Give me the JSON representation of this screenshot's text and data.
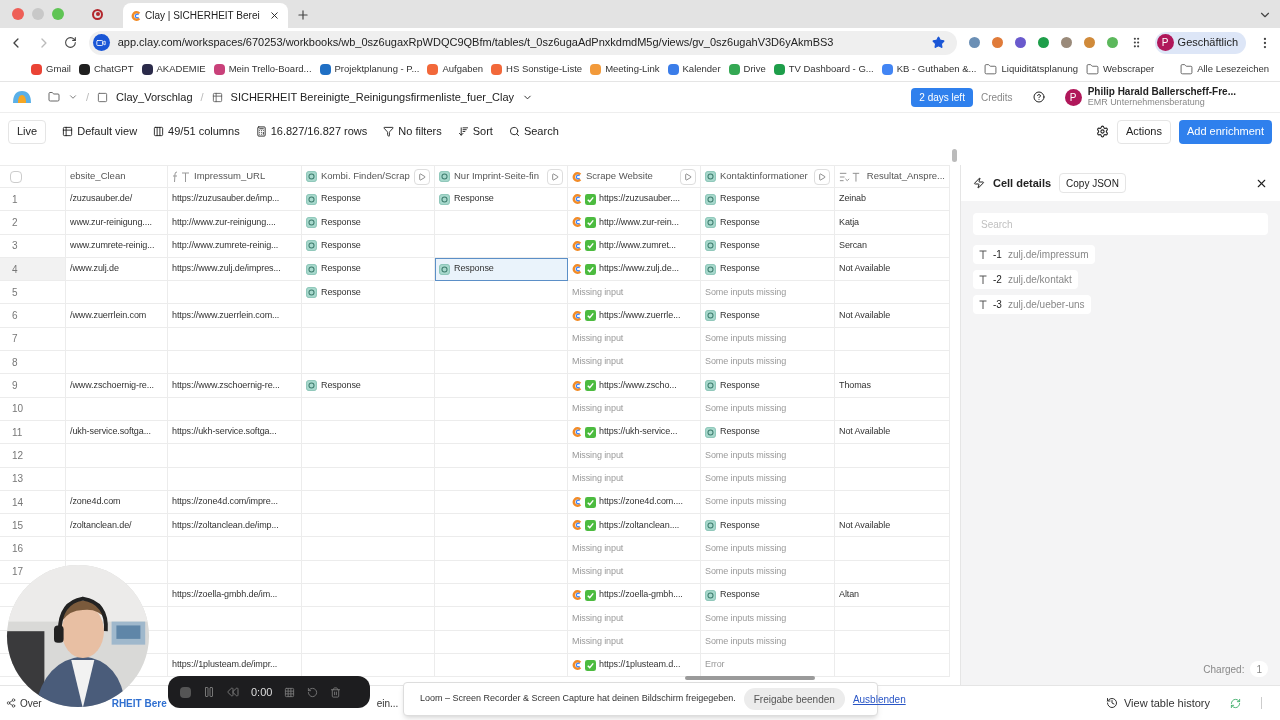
{
  "browser": {
    "tab_title": "Clay | SICHERHEIT Berei",
    "url": "app.clay.com/workspaces/670253/workbooks/wb_0sz6ugaxRpWDQC9QBfm/tables/t_0sz6ugaAdPnxkdmdM5g/views/gv_0sz6ugahV3D6yAkmBS3",
    "profile": "Geschäftlich",
    "profile_initial": "P",
    "bookmarks": [
      {
        "label": "Gmail",
        "kind": "site",
        "color": "#ea4335"
      },
      {
        "label": "ChatGPT",
        "kind": "site",
        "color": "#1f1f1f"
      },
      {
        "label": "AKADEMIE",
        "kind": "site",
        "color": "#2b2b4a"
      },
      {
        "label": "Mein Trello-Board...",
        "kind": "site",
        "color": "#c9417a"
      },
      {
        "label": "Projektplanung - P...",
        "kind": "site",
        "color": "#1f6fc4"
      },
      {
        "label": "Aufgaben",
        "kind": "site",
        "color": "#f2683a"
      },
      {
        "label": "HS Sonstige-Liste",
        "kind": "site",
        "color": "#f2683a"
      },
      {
        "label": "Meeting-Link",
        "kind": "site",
        "color": "#f29a3a"
      },
      {
        "label": "Kalender",
        "kind": "site",
        "color": "#3b7de9"
      },
      {
        "label": "Drive",
        "kind": "site",
        "color": "#34a853"
      },
      {
        "label": "TV Dashboard - G...",
        "kind": "site",
        "color": "#1e9e4a"
      },
      {
        "label": "KB - Guthaben &...",
        "kind": "site",
        "color": "#4285f4"
      },
      {
        "label": "Liquiditätsplanung",
        "kind": "folder"
      },
      {
        "label": "Webscraper",
        "kind": "folder"
      },
      {
        "label": "Alle Lesezeichen",
        "kind": "folder"
      }
    ]
  },
  "app_header": {
    "separator": "/",
    "breadcrumbs": [
      "Clay_Vorschlag",
      "SICHERHEIT Bereinigte_Reinigungsfirmenliste_fuer_Clay"
    ],
    "trial": "2 days left",
    "credits": "Credits",
    "user": {
      "initial": "P",
      "name": "Philip Harald Ballerscheff-Fre...",
      "org": "EMR Unternehmensberatung"
    }
  },
  "toolbar": {
    "mode": "Live",
    "view": "Default view",
    "columns": "49/51 columns",
    "rows": "16.827/16.827 rows",
    "filters": "No filters",
    "sort": "Sort",
    "search": "Search",
    "actions": "Actions",
    "add": "Add enrichment"
  },
  "table": {
    "select_all": {
      "checked": false
    },
    "columns": [
      {
        "label": "ebsite_Clean",
        "kind": "plain",
        "run": false
      },
      {
        "label": "Impressum_URL",
        "kind": "formula",
        "run": false
      },
      {
        "label": "Kombi. Finden/Scrap",
        "kind": "ai",
        "run": true
      },
      {
        "label": "Nur Imprint-Seite-fin",
        "kind": "ai",
        "run": true
      },
      {
        "label": "Scrape Website",
        "kind": "scrape",
        "run": true
      },
      {
        "label": "Kontaktinformationer",
        "kind": "ai",
        "run": true
      },
      {
        "label": "Resultat_Anspre...",
        "kind": "list",
        "run": false
      }
    ],
    "rows": [
      {
        "number": "1",
        "cells": [
          {
            "kind": "text",
            "text": "/zuzusauber.de/",
            "selected": false
          },
          {
            "kind": "text",
            "text": "https://zuzusauber.de/imp...",
            "selected": false
          },
          {
            "kind": "response",
            "text": "Response",
            "selected": false
          },
          {
            "kind": "response",
            "text": "Response",
            "selected": false
          },
          {
            "kind": "scrape",
            "text": "https://zuzusauber....",
            "selected": false
          },
          {
            "kind": "response",
            "text": "Response",
            "selected": false
          },
          {
            "kind": "text",
            "text": "Zeinab",
            "selected": false
          }
        ]
      },
      {
        "number": "2",
        "cells": [
          {
            "kind": "text",
            "text": "www.zur-reinigung....",
            "selected": false
          },
          {
            "kind": "text",
            "text": "http://www.zur-reinigung....",
            "selected": false
          },
          {
            "kind": "response",
            "text": "Response",
            "selected": false
          },
          {
            "kind": "empty",
            "selected": false
          },
          {
            "kind": "scrape",
            "text": "http://www.zur-rein...",
            "selected": false
          },
          {
            "kind": "response",
            "text": "Response",
            "selected": false
          },
          {
            "kind": "text",
            "text": "Katja",
            "selected": false
          }
        ]
      },
      {
        "number": "3",
        "cells": [
          {
            "kind": "text",
            "text": "www.zumrete-reinig...",
            "selected": false
          },
          {
            "kind": "text",
            "text": "http://www.zumrete-reinig...",
            "selected": false
          },
          {
            "kind": "response",
            "text": "Response",
            "selected": false
          },
          {
            "kind": "empty",
            "selected": false
          },
          {
            "kind": "scrape",
            "text": "http://www.zumret...",
            "selected": false
          },
          {
            "kind": "response",
            "text": "Response",
            "selected": false
          },
          {
            "kind": "text",
            "text": "Sercan",
            "selected": false
          }
        ]
      },
      {
        "number": "4",
        "cells": [
          {
            "kind": "text",
            "text": "/www.zulj.de",
            "selected": false
          },
          {
            "kind": "text",
            "text": "https://www.zulj.de/impres...",
            "selected": false
          },
          {
            "kind": "response",
            "text": "Response",
            "selected": false
          },
          {
            "kind": "response",
            "text": "Response",
            "selected": true
          },
          {
            "kind": "scrape",
            "text": "https://www.zulj.de...",
            "selected": false
          },
          {
            "kind": "response",
            "text": "Response",
            "selected": false
          },
          {
            "kind": "text",
            "text": "Not Available",
            "selected": false
          }
        ]
      },
      {
        "number": "5",
        "cells": [
          {
            "kind": "empty",
            "selected": false
          },
          {
            "kind": "empty",
            "selected": false
          },
          {
            "kind": "response",
            "text": "Response",
            "selected": false
          },
          {
            "kind": "empty",
            "selected": false
          },
          {
            "kind": "muted",
            "text": "Missing input",
            "selected": false
          },
          {
            "kind": "muted",
            "text": "Some inputs missing",
            "selected": false
          },
          {
            "kind": "empty",
            "selected": false
          }
        ]
      },
      {
        "number": "6",
        "cells": [
          {
            "kind": "text",
            "text": "/www.zuerrlein.com",
            "selected": false
          },
          {
            "kind": "text",
            "text": "https://www.zuerrlein.com...",
            "selected": false
          },
          {
            "kind": "empty",
            "selected": false
          },
          {
            "kind": "empty",
            "selected": false
          },
          {
            "kind": "scrape",
            "text": "https://www.zuerrle...",
            "selected": false
          },
          {
            "kind": "response",
            "text": "Response",
            "selected": false
          },
          {
            "kind": "text",
            "text": "Not Available",
            "selected": false
          }
        ]
      },
      {
        "number": "7",
        "cells": [
          {
            "kind": "empty",
            "selected": false
          },
          {
            "kind": "empty",
            "selected": false
          },
          {
            "kind": "empty",
            "selected": false
          },
          {
            "kind": "empty",
            "selected": false
          },
          {
            "kind": "muted",
            "text": "Missing input",
            "selected": false
          },
          {
            "kind": "muted",
            "text": "Some inputs missing",
            "selected": false
          },
          {
            "kind": "empty",
            "selected": false
          }
        ]
      },
      {
        "number": "8",
        "cells": [
          {
            "kind": "empty",
            "selected": false
          },
          {
            "kind": "empty",
            "selected": false
          },
          {
            "kind": "empty",
            "selected": false
          },
          {
            "kind": "empty",
            "selected": false
          },
          {
            "kind": "muted",
            "text": "Missing input",
            "selected": false
          },
          {
            "kind": "muted",
            "text": "Some inputs missing",
            "selected": false
          },
          {
            "kind": "empty",
            "selected": false
          }
        ]
      },
      {
        "number": "9",
        "cells": [
          {
            "kind": "text",
            "text": "/www.zschoernig-re...",
            "selected": false
          },
          {
            "kind": "text",
            "text": "https://www.zschoernig-re...",
            "selected": false
          },
          {
            "kind": "response",
            "text": "Response",
            "selected": false
          },
          {
            "kind": "empty",
            "selected": false
          },
          {
            "kind": "scrape",
            "text": "https://www.zscho...",
            "selected": false
          },
          {
            "kind": "response",
            "text": "Response",
            "selected": false
          },
          {
            "kind": "text",
            "text": "Thomas",
            "selected": false
          }
        ]
      },
      {
        "number": "10",
        "cells": [
          {
            "kind": "empty",
            "selected": false
          },
          {
            "kind": "empty",
            "selected": false
          },
          {
            "kind": "empty",
            "selected": false
          },
          {
            "kind": "empty",
            "selected": false
          },
          {
            "kind": "muted",
            "text": "Missing input",
            "selected": false
          },
          {
            "kind": "muted",
            "text": "Some inputs missing",
            "selected": false
          },
          {
            "kind": "empty",
            "selected": false
          }
        ]
      },
      {
        "number": "11",
        "cells": [
          {
            "kind": "text",
            "text": "/ukh-service.softga...",
            "selected": false
          },
          {
            "kind": "text",
            "text": "https://ukh-service.softga...",
            "selected": false
          },
          {
            "kind": "empty",
            "selected": false
          },
          {
            "kind": "empty",
            "selected": false
          },
          {
            "kind": "scrape",
            "text": "https://ukh-service...",
            "selected": false
          },
          {
            "kind": "response",
            "text": "Response",
            "selected": false
          },
          {
            "kind": "text",
            "text": "Not Available",
            "selected": false
          }
        ]
      },
      {
        "number": "12",
        "cells": [
          {
            "kind": "empty",
            "selected": false
          },
          {
            "kind": "empty",
            "selected": false
          },
          {
            "kind": "empty",
            "selected": false
          },
          {
            "kind": "empty",
            "selected": false
          },
          {
            "kind": "muted",
            "text": "Missing input",
            "selected": false
          },
          {
            "kind": "muted",
            "text": "Some inputs missing",
            "selected": false
          },
          {
            "kind": "empty",
            "selected": false
          }
        ]
      },
      {
        "number": "13",
        "cells": [
          {
            "kind": "empty",
            "selected": false
          },
          {
            "kind": "empty",
            "selected": false
          },
          {
            "kind": "empty",
            "selected": false
          },
          {
            "kind": "empty",
            "selected": false
          },
          {
            "kind": "muted",
            "text": "Missing input",
            "selected": false
          },
          {
            "kind": "muted",
            "text": "Some inputs missing",
            "selected": false
          },
          {
            "kind": "empty",
            "selected": false
          }
        ]
      },
      {
        "number": "14",
        "cells": [
          {
            "kind": "text",
            "text": "/zone4d.com",
            "selected": false
          },
          {
            "kind": "text",
            "text": "https://zone4d.com/impre...",
            "selected": false
          },
          {
            "kind": "empty",
            "selected": false
          },
          {
            "kind": "empty",
            "selected": false
          },
          {
            "kind": "scrape",
            "text": "https://zone4d.com....",
            "selected": false
          },
          {
            "kind": "muted",
            "text": "Some inputs missing",
            "selected": false
          },
          {
            "kind": "empty",
            "selected": false
          }
        ]
      },
      {
        "number": "15",
        "cells": [
          {
            "kind": "text",
            "text": "/zoltanclean.de/",
            "selected": false
          },
          {
            "kind": "text",
            "text": "https://zoltanclean.de/imp...",
            "selected": false
          },
          {
            "kind": "empty",
            "selected": false
          },
          {
            "kind": "empty",
            "selected": false
          },
          {
            "kind": "scrape",
            "text": "https://zoltanclean....",
            "selected": false
          },
          {
            "kind": "response",
            "text": "Response",
            "selected": false
          },
          {
            "kind": "text",
            "text": "Not Available",
            "selected": false
          }
        ]
      },
      {
        "number": "16",
        "cells": [
          {
            "kind": "empty",
            "selected": false
          },
          {
            "kind": "empty",
            "selected": false
          },
          {
            "kind": "empty",
            "selected": false
          },
          {
            "kind": "empty",
            "selected": false
          },
          {
            "kind": "muted",
            "text": "Missing input",
            "selected": false
          },
          {
            "kind": "muted",
            "text": "Some inputs missing",
            "selected": false
          },
          {
            "kind": "empty",
            "selected": false
          }
        ]
      },
      {
        "number": "17",
        "cells": [
          {
            "kind": "empty",
            "selected": false
          },
          {
            "kind": "empty",
            "selected": false
          },
          {
            "kind": "empty",
            "selected": false
          },
          {
            "kind": "empty",
            "selected": false
          },
          {
            "kind": "muted",
            "text": "Missing input",
            "selected": false
          },
          {
            "kind": "muted",
            "text": "Some inputs missing",
            "selected": false
          },
          {
            "kind": "empty",
            "selected": false
          }
        ]
      },
      {
        "cells": [
          {
            "kind": "empty",
            "selected": false
          },
          {
            "kind": "text",
            "text": "https://zoella-gmbh.de/im...",
            "selected": false
          },
          {
            "kind": "empty",
            "selected": false
          },
          {
            "kind": "empty",
            "selected": false
          },
          {
            "kind": "scrape",
            "text": "https://zoella-gmbh....",
            "selected": false
          },
          {
            "kind": "response",
            "text": "Response",
            "selected": false
          },
          {
            "kind": "text",
            "text": "Altan",
            "selected": false
          }
        ]
      },
      {
        "cells": [
          {
            "kind": "empty",
            "selected": false
          },
          {
            "kind": "empty",
            "selected": false
          },
          {
            "kind": "empty",
            "selected": false
          },
          {
            "kind": "empty",
            "selected": false
          },
          {
            "kind": "muted",
            "text": "Missing input",
            "selected": false
          },
          {
            "kind": "muted",
            "text": "Some inputs missing",
            "selected": false
          },
          {
            "kind": "empty",
            "selected": false
          }
        ]
      },
      {
        "cells": [
          {
            "kind": "empty",
            "selected": false
          },
          {
            "kind": "empty",
            "selected": false
          },
          {
            "kind": "empty",
            "selected": false
          },
          {
            "kind": "empty",
            "selected": false
          },
          {
            "kind": "muted",
            "text": "Missing input",
            "selected": false
          },
          {
            "kind": "muted",
            "text": "Some inputs missing",
            "selected": false
          },
          {
            "kind": "empty",
            "selected": false
          }
        ]
      },
      {
        "cells": [
          {
            "kind": "empty",
            "selected": false
          },
          {
            "kind": "text",
            "text": "https://1plusteam.de/impr...",
            "selected": false
          },
          {
            "kind": "empty",
            "selected": false
          },
          {
            "kind": "empty",
            "selected": false
          },
          {
            "kind": "scrape",
            "text": "https://1plusteam.d...",
            "selected": false
          },
          {
            "kind": "muted",
            "text": "Error",
            "selected": false
          },
          {
            "kind": "empty",
            "selected": false
          }
        ]
      }
    ]
  },
  "cell_details": {
    "title": "Cell details",
    "copy": "Copy JSON",
    "search": {
      "placeholder": "Search"
    },
    "items": [
      {
        "index": "-1",
        "value": "zulj.de/impressum"
      },
      {
        "index": "-2",
        "value": "zulj.de/kontakt"
      },
      {
        "index": "-3",
        "value": "zulj.de/ueber-uns"
      }
    ],
    "charged_label": "Charged:",
    "charged": "1"
  },
  "bottom_bar": {
    "tabs": [
      {
        "label": "Over",
        "selected": false
      },
      {
        "label": "RHEIT Bere",
        "selected": true
      },
      {
        "label": "ein...",
        "selected": false
      }
    ],
    "history": "View table history"
  },
  "overlays": {
    "recorder": {
      "time": "0:00"
    },
    "loom": {
      "message": "Loom – Screen Recorder & Screen Capture hat deinen Bildschirm freigegeben.",
      "stop": "Freigabe beenden",
      "hide": "Ausblenden"
    }
  }
}
